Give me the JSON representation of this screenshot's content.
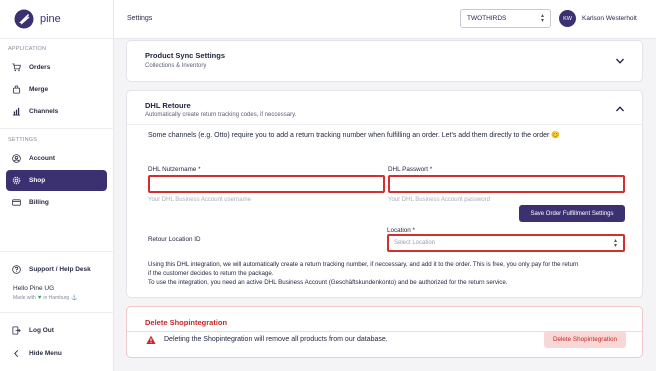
{
  "brand": {
    "name": "pine",
    "accent": "#3c3170",
    "danger": "#c62828"
  },
  "sidebar": {
    "sections": {
      "application": "APPLICATION",
      "settings": "SETTINGS"
    },
    "application_items": [
      {
        "label": "Orders",
        "icon": "cart-icon"
      },
      {
        "label": "Merge",
        "icon": "bag-icon"
      },
      {
        "label": "Channels",
        "icon": "bar-chart-icon"
      }
    ],
    "settings_items": [
      {
        "label": "Account",
        "icon": "user-circle-icon"
      },
      {
        "label": "Shop",
        "icon": "gear-icon",
        "active": true
      },
      {
        "label": "Billing",
        "icon": "credit-card-icon"
      }
    ],
    "support": "Support / Help Desk",
    "org_name": "Hello Pine UG",
    "made_with": "Made with",
    "made_in": "in Hamburg",
    "logout": "Log Out",
    "hide_menu": "Hide Menu"
  },
  "header": {
    "title": "Settings",
    "store_selected": "TWOTHIRDS",
    "user_initials": "KW",
    "user_name": "Karlson Westerholt"
  },
  "product_sync": {
    "title": "Product Sync Settings",
    "subtitle": "Collections & Inventory"
  },
  "dhl": {
    "title": "DHL Retoure",
    "subtitle": "Automatically create return tracking codes, if neccessary.",
    "intro": "Some channels (e.g. Otto) require you to add a return tracking number when fulfilling an order. Let's add them directly to the order 😊",
    "username_label": "DHL Nutzername *",
    "username_hint": "Your DHL Business Account username",
    "password_label": "DHL Passwort *",
    "password_hint": "Your DHL Business Account password",
    "save_button": "Save Order Fulfillment Settings",
    "retour_location_label": "Retour Location ID",
    "location_label": "Location *",
    "location_placeholder": "Select Location",
    "info_line1": "Using this DHL integration, we will automatically create a return tracking number, if neccessary, and add it to the order. This is free, you only pay for the return",
    "info_line2": "if the customer decides to return the package.",
    "info_line3": "To use the integration, you need an active DHL Business Account (Geschäftskundenkonto) and be authorized for the return service."
  },
  "danger": {
    "title": "Delete Shopintegration",
    "text": "Deleting the Shopintegration will remove all products from our database.",
    "button": "Delete Shopintegration"
  }
}
